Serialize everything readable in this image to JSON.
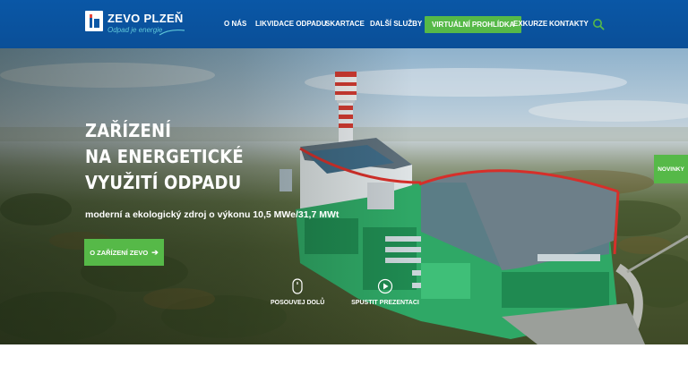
{
  "brand": {
    "name": "ZEVO PLZEŇ",
    "tagline": "Odpad je energie",
    "colors": {
      "header_blue": "#0a57a6",
      "accent_green": "#56b948",
      "tagline_cyan": "#5fc6d8"
    }
  },
  "nav": {
    "items": [
      {
        "label": "O NÁS"
      },
      {
        "label": "LIKVIDACE ODPADU"
      },
      {
        "label": "SKARTACE"
      },
      {
        "label": "DALŠÍ SLUŽBY"
      },
      {
        "label": "VIRTUÁLNÍ PROHLÍDKA",
        "highlighted": true
      },
      {
        "label": "EXKURZE"
      },
      {
        "label": "KONTAKTY"
      }
    ],
    "search_icon": "search-icon"
  },
  "hero": {
    "title_lines": [
      "ZAŘÍZENÍ",
      "NA ENERGETICKÉ",
      "VYUŽITÍ ODPADU"
    ],
    "subtitle": "moderní a ekologický zdroj o výkonu 10,5 MWe/31,7 MWt",
    "cta_label": "O ZAŘÍZENÍ ZEVO",
    "cta_icon": "arrow-right-icon",
    "actions": [
      {
        "label": "POSOUVEJ DOLŮ",
        "icon": "mouse-icon"
      },
      {
        "label": "SPUSTIT PREZENTACI",
        "icon": "play-circle-icon"
      }
    ]
  },
  "side_tab": {
    "label": "NOVINKY"
  }
}
